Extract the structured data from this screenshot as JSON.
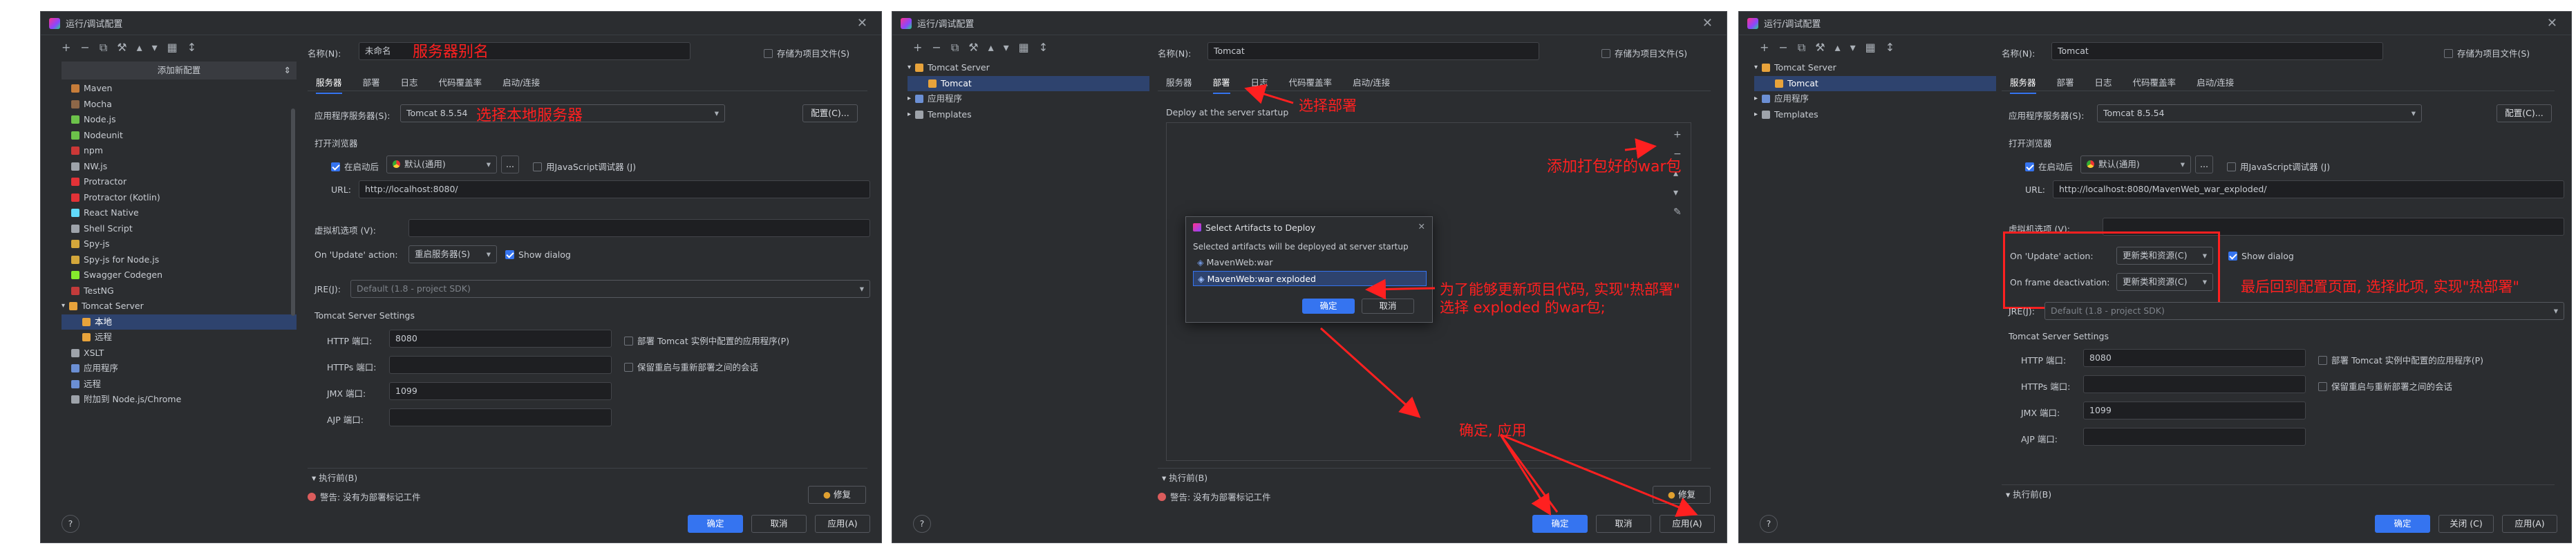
{
  "colors": {
    "accent": "#3574f0",
    "annotation": "#ff2020",
    "bg": "#2b2d30"
  },
  "p1": {
    "title": "运行/调试配置",
    "add_template_label": "添加新配置",
    "tree": [
      {
        "label": "Maven",
        "icon": "maven-icon",
        "color": "#c77d3a"
      },
      {
        "label": "Mocha",
        "icon": "mocha-icon",
        "color": "#8d6748"
      },
      {
        "label": "Node.js",
        "icon": "nodejs-icon",
        "color": "#6cc24a"
      },
      {
        "label": "Nodeunit",
        "icon": "nodeunit-icon",
        "color": "#6cc24a"
      },
      {
        "label": "npm",
        "icon": "npm-icon",
        "color": "#cb3837"
      },
      {
        "label": "NW.js",
        "icon": "nwjs-icon",
        "color": "#9ea3aa"
      },
      {
        "label": "Protractor",
        "icon": "protractor-icon",
        "color": "#e23237"
      },
      {
        "label": "Protractor (Kotlin)",
        "icon": "protractor-kotlin-icon",
        "color": "#e23237"
      },
      {
        "label": "React Native",
        "icon": "react-icon",
        "color": "#61dafb"
      },
      {
        "label": "Shell Script",
        "icon": "shell-icon",
        "color": "#9ea3aa"
      },
      {
        "label": "Spy-js",
        "icon": "spyjs-icon",
        "color": "#d4a73b"
      },
      {
        "label": "Spy-js for Node.js",
        "icon": "spyjs-node-icon",
        "color": "#d4a73b"
      },
      {
        "label": "Swagger Codegen",
        "icon": "swagger-icon",
        "color": "#85ea2d"
      },
      {
        "label": "TestNG",
        "icon": "testng-icon",
        "color": "#c23b3b"
      },
      {
        "label": "Tomcat Server",
        "icon": "tomcat-icon",
        "color": "#e8a33b"
      },
      {
        "label": "本地",
        "icon": "tomcat-local-icon",
        "color": "#e8a33b"
      },
      {
        "label": "远程",
        "icon": "tomcat-remote-icon",
        "color": "#e8a33b"
      },
      {
        "label": "XSLT",
        "icon": "xslt-icon",
        "color": "#9ea3aa"
      },
      {
        "label": "应用程序",
        "icon": "application-icon",
        "color": "#6b8fd4"
      },
      {
        "label": "远程",
        "icon": "remote-icon",
        "color": "#6b8fd4"
      },
      {
        "label": "附加到 Node.js/Chrome",
        "icon": "attach-icon",
        "color": "#9ea3aa"
      }
    ],
    "name_label": "名称(N):",
    "name_value": "未命名",
    "name_annotation": "服务器别名",
    "store_label": "存储为项目文件(S)",
    "tabs": [
      "服务器",
      "部署",
      "日志",
      "代码覆盖率",
      "启动/连接"
    ],
    "app_server_label": "应用程序服务器(S):",
    "app_server_value": "Tomcat 8.5.54",
    "app_server_annotation": "选择本地服务器",
    "configure_button": "配置(C)...",
    "open_browser_label": "打开浏览器",
    "after_launch_label": "在启动后",
    "browser_value": "默认(通用)",
    "ellipsis": "...",
    "js_debugger_label": "用JavaScript调试器 (J)",
    "url_label": "URL:",
    "url_value": "http://localhost:8080/",
    "vm_label": "虚拟机选项 (V):",
    "on_update_label": "On 'Update' action:",
    "on_update_value": "重启服务器(S)",
    "show_dialog_label": "Show dialog",
    "jre_label": "JRE(J):",
    "jre_value": "Default (1.8 - project SDK)",
    "tomcat_settings_label": "Tomcat Server Settings",
    "http_port_label": "HTTP 端口:",
    "http_port_value": "8080",
    "https_port_label": "HTTPs 端口:",
    "jmx_port_label": "JMX 端口:",
    "jmx_port_value": "1099",
    "ajp_port_label": "AJP 端口:",
    "deploy_in_tomcat_label": "部署 Tomcat 实例中配置的应用程序(P)",
    "preserve_sessions_label": "保留重启与重新部署之间的会话",
    "before_launch_label": "执行前(B)",
    "warning_text": "警告: 没有为部署标记工件",
    "fix_button": "修复",
    "ok_button": "确定",
    "cancel_button": "取消",
    "apply_button": "应用(A)"
  },
  "p2": {
    "title": "运行/调试配置",
    "tree": [
      {
        "label": "Tomcat Server",
        "icon": "tomcat-icon",
        "color": "#e8a33b"
      },
      {
        "label": "Tomcat",
        "icon": "tomcat-icon",
        "color": "#e8a33b"
      },
      {
        "label": "应用程序",
        "icon": "application-icon",
        "color": "#6b8fd4"
      },
      {
        "label": "Templates",
        "icon": "wrench-icon",
        "color": "#9ea3aa"
      }
    ],
    "name_label": "名称(N):",
    "name_value": "Tomcat",
    "store_label": "存储为项目文件(S)",
    "tabs": [
      "服务器",
      "部署",
      "日志",
      "代码覆盖率",
      "启动/连接"
    ],
    "tab_annotation": "选择部署",
    "deploy_startup_label": "Deploy at the server startup",
    "add_war_annotation": "添加打包好的war包",
    "dialog_title": "Select Artifacts to Deploy",
    "dialog_desc": "Selected artifacts will be deployed at server startup",
    "artifacts": [
      "MavenWeb:war",
      "MavenWeb:war exploded"
    ],
    "dialog_ok": "确定",
    "dialog_cancel": "取消",
    "annotation_line1": "为了能够更新项目代码, 实现\"热部署\"",
    "annotation_line2": "选择 exploded 的war包;",
    "annotation_ok": "确定, 应用",
    "before_launch_label": "执行前(B)",
    "warning_text": "警告: 没有为部署标记工件",
    "fix_button": "修复",
    "ok_button": "确定",
    "cancel_button": "取消",
    "apply_button": "应用(A)"
  },
  "p3": {
    "title": "运行/调试配置",
    "tree": [
      {
        "label": "Tomcat Server",
        "icon": "tomcat-icon",
        "color": "#e8a33b"
      },
      {
        "label": "Tomcat",
        "icon": "tomcat-icon",
        "color": "#e8a33b"
      },
      {
        "label": "应用程序",
        "icon": "application-icon",
        "color": "#6b8fd4"
      },
      {
        "label": "Templates",
        "icon": "wrench-icon",
        "color": "#9ea3aa"
      }
    ],
    "name_label": "名称(N):",
    "name_value": "Tomcat",
    "store_label": "存储为项目文件(S)",
    "tabs": [
      "服务器",
      "部署",
      "日志",
      "代码覆盖率",
      "启动/连接"
    ],
    "app_server_label": "应用程序服务器(S):",
    "app_server_value": "Tomcat 8.5.54",
    "configure_button": "配置(C)...",
    "open_browser_label": "打开浏览器",
    "after_launch_label": "在启动后",
    "browser_value": "默认(通用)",
    "js_debugger_label": "用JavaScript调试器 (J)",
    "url_label": "URL:",
    "url_value": "http://localhost:8080/MavenWeb_war_exploded/",
    "vm_label": "虚拟机选项 (V):",
    "on_update_label": "On 'Update' action:",
    "on_update_value": "更新类和资源(C)",
    "show_dialog_label": "Show dialog",
    "on_frame_label": "On frame deactivation:",
    "on_frame_value": "更新类和资源(C)",
    "annotation": "最后回到配置页面, 选择此项, 实现\"热部署\"",
    "jre_label": "JRE(J):",
    "jre_value": "Default (1.8 - project SDK)",
    "tomcat_settings_label": "Tomcat Server Settings",
    "http_port_label": "HTTP 端口:",
    "http_port_value": "8080",
    "https_port_label": "HTTPs 端口:",
    "jmx_port_label": "JMX 端口:",
    "jmx_port_value": "1099",
    "ajp_port_label": "AJP 端口:",
    "deploy_in_tomcat_label": "部署 Tomcat 实例中配置的应用程序(P)",
    "preserve_sessions_label": "保留重启与重新部署之间的会话",
    "before_launch_label": "执行前(B)",
    "ok_button": "确定",
    "close_button": "关闭 (C)",
    "apply_button": "应用(A)"
  }
}
